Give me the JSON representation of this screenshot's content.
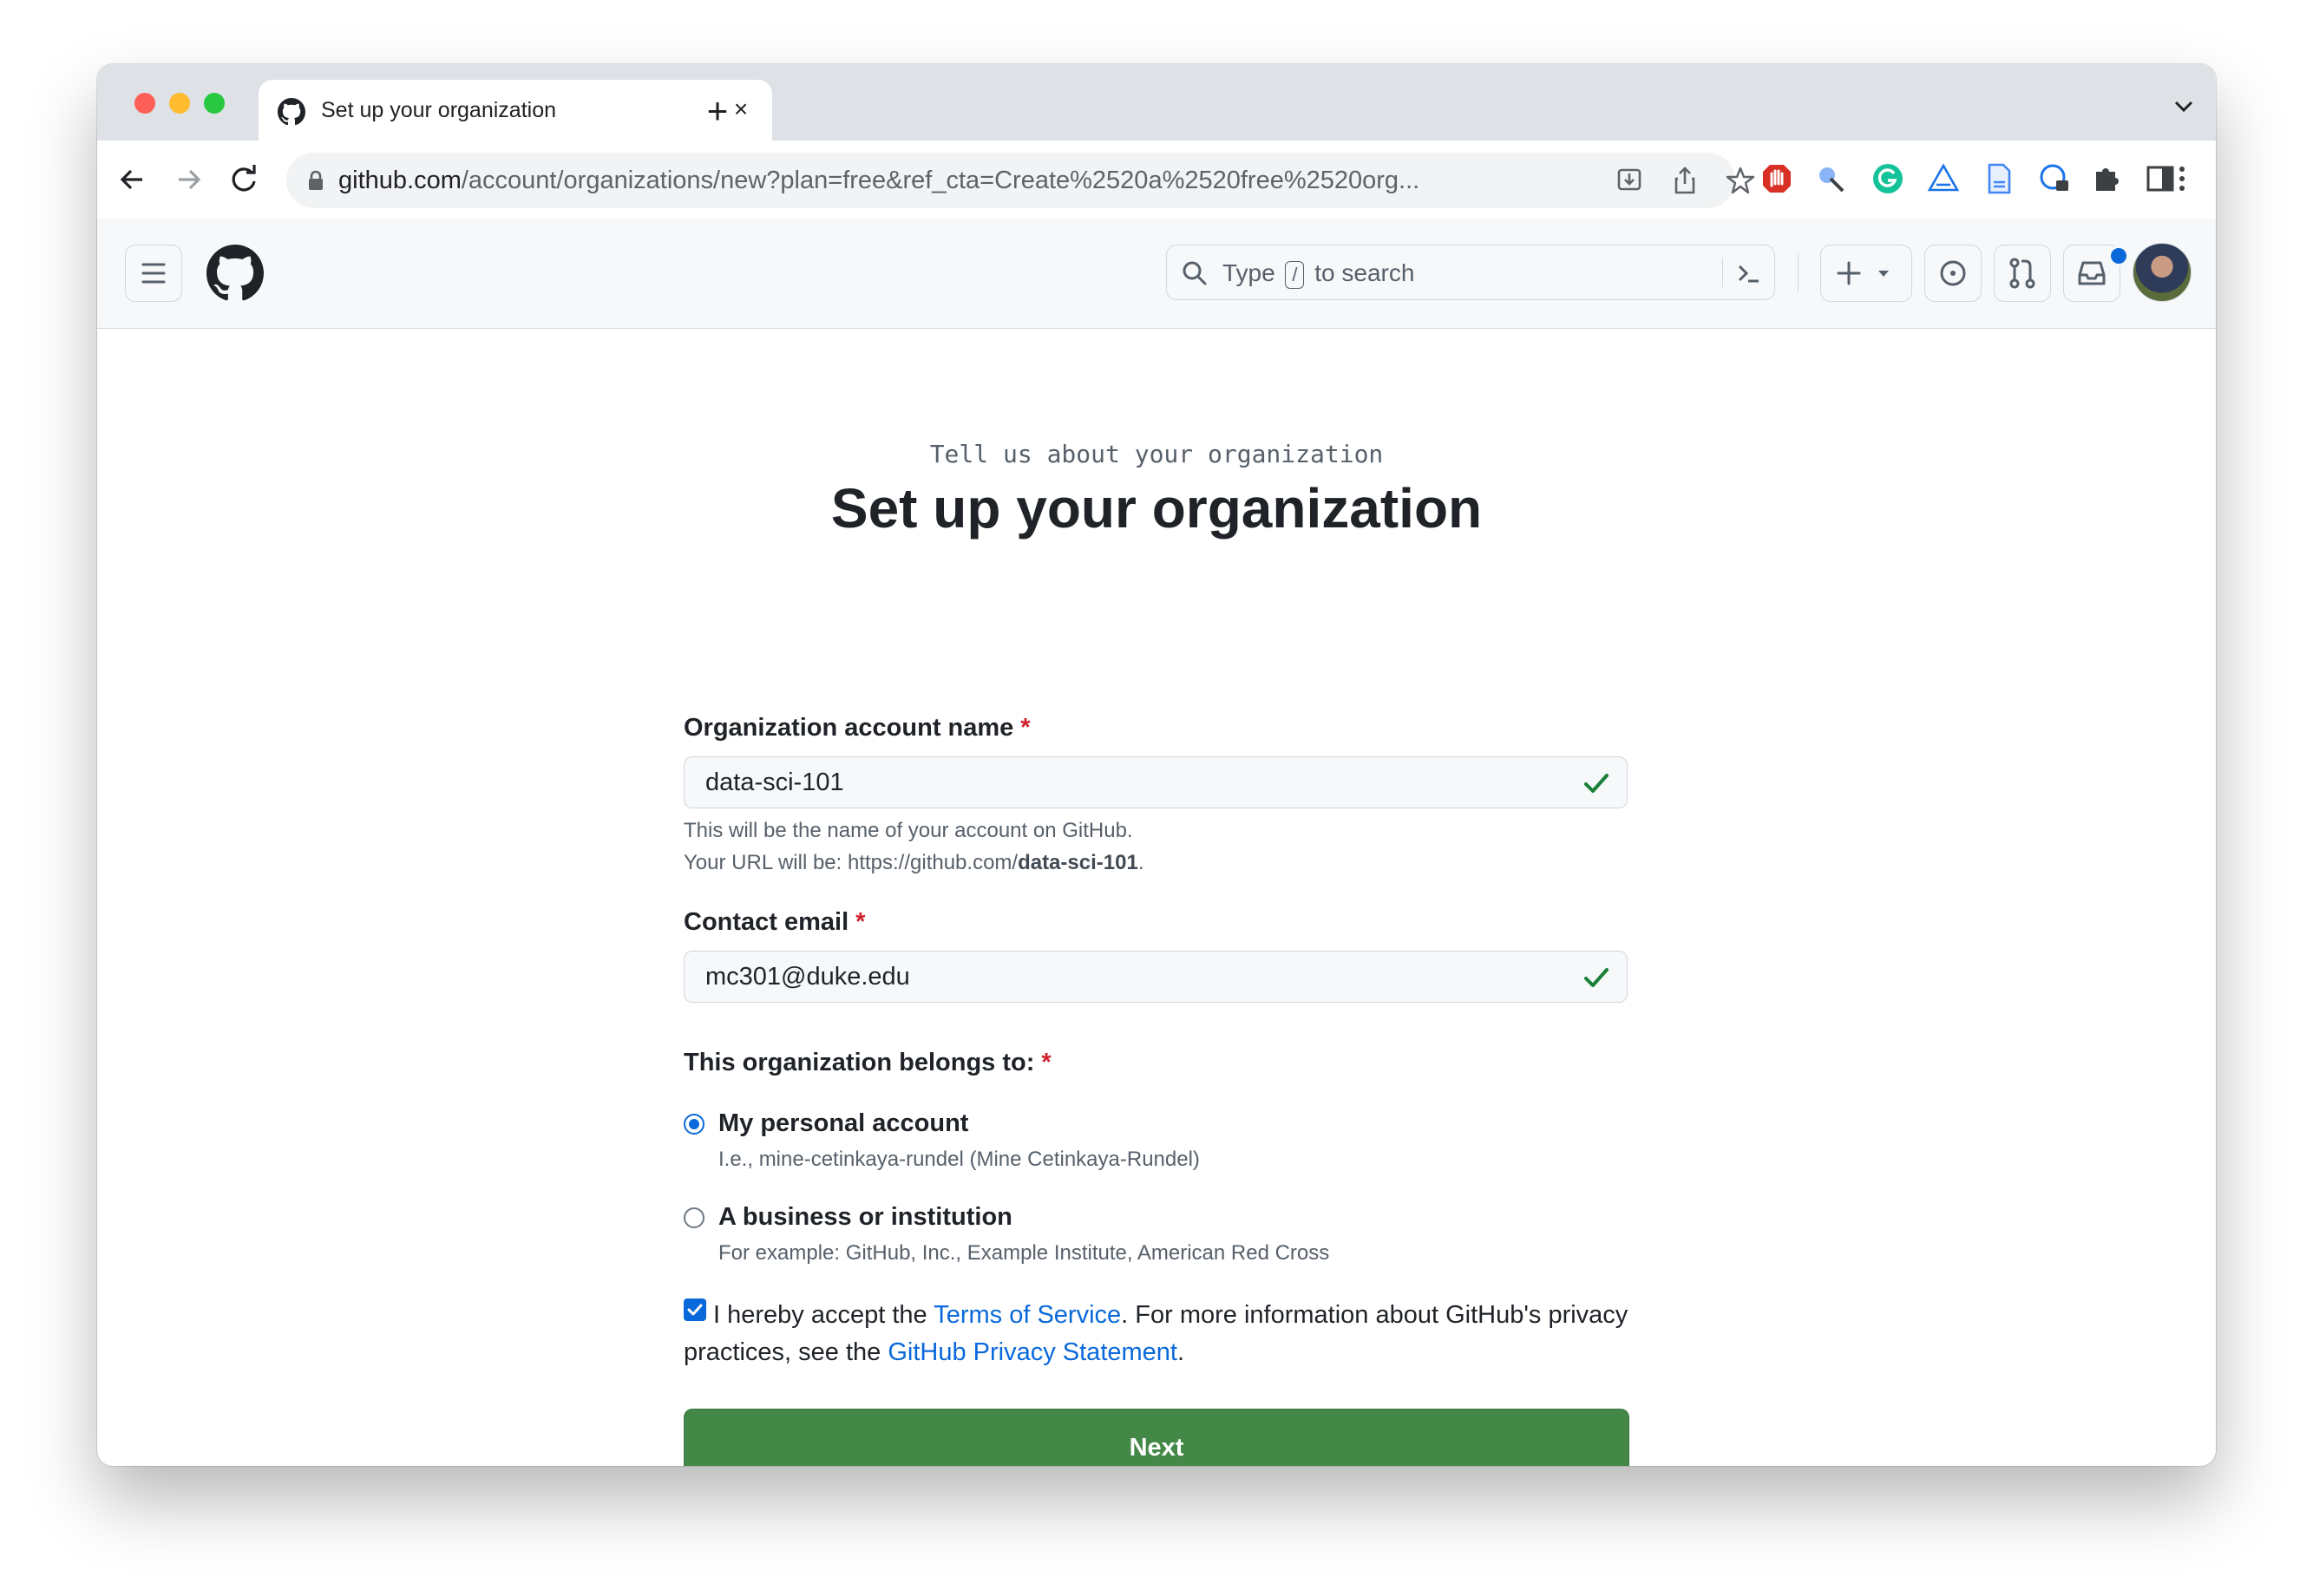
{
  "browser": {
    "tab_title": "Set up your organization",
    "new_tab_symbol": "+",
    "close_symbol": "×",
    "url_host": "github.com",
    "url_path": "/account/organizations/new?plan=free&ref_cta=Create%2520a%2520free%2520org..."
  },
  "header": {
    "search_prefix": "Type",
    "search_key": "/",
    "search_suffix": "to search"
  },
  "page": {
    "eyebrow": "Tell us about your organization",
    "title": "Set up your organization"
  },
  "form": {
    "org_name": {
      "label": "Organization account name",
      "required_mark": "*",
      "value": "data-sci-101",
      "help_line1": "This will be the name of your account on GitHub.",
      "help_line2_prefix": "Your URL will be: https://github.com/",
      "help_line2_handle": "data-sci-101",
      "help_line2_suffix": "."
    },
    "email": {
      "label": "Contact email",
      "required_mark": "*",
      "value": "mc301@duke.edu"
    },
    "belongs_to": {
      "label": "This organization belongs to:",
      "required_mark": "*",
      "options": [
        {
          "label": "My personal account",
          "note": "I.e., mine-cetinkaya-rundel (Mine Cetinkaya-Rundel)",
          "selected": true
        },
        {
          "label": "A business or institution",
          "note": "For example: GitHub, Inc., Example Institute, American Red Cross",
          "selected": false
        }
      ]
    },
    "terms": {
      "checked": true,
      "part1": "I hereby accept the ",
      "tos_link": "Terms of Service",
      "part2": ". For more information about GitHub's privacy practices, see the ",
      "privacy_link": "GitHub Privacy Statement",
      "part3": "."
    },
    "next_label": "Next"
  },
  "colors": {
    "primary_button": "#438847",
    "link": "#0969da",
    "required": "#cf222e",
    "valid_check": "#1a7f37"
  }
}
